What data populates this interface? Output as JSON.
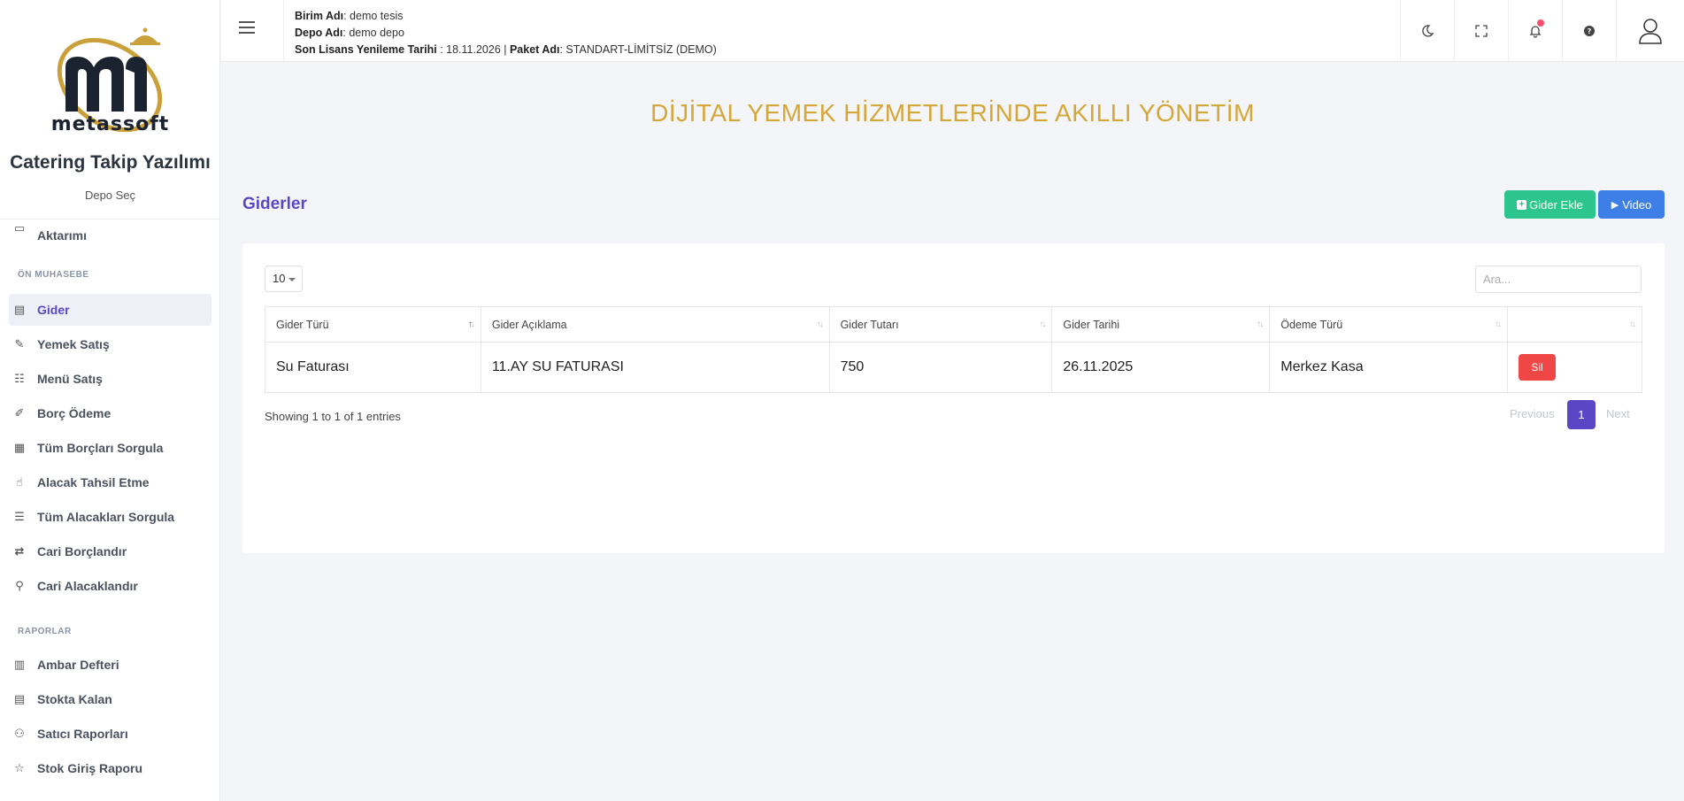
{
  "sidebar": {
    "logo_text": "metassoft",
    "app_title": "Catering Takip Yazılımı",
    "depo_sec": "Depo Seç",
    "partial_item": "Aktarımı",
    "section_on_muhasebe": "ÖN MUHASEBE",
    "section_raporlar": "RAPORLAR",
    "items": [
      {
        "label": "Gider",
        "icon": "register-icon"
      },
      {
        "label": "Yemek Satış",
        "icon": "food-sale-icon"
      },
      {
        "label": "Menü Satış",
        "icon": "menu-sale-icon"
      },
      {
        "label": "Borç Ödeme",
        "icon": "payment-icon"
      },
      {
        "label": "Tüm Borçları Sorgula",
        "icon": "debt-query-icon"
      },
      {
        "label": "Alacak Tahsil Etme",
        "icon": "collect-icon"
      },
      {
        "label": "Tüm Alacakları Sorgula",
        "icon": "receivable-query-icon"
      },
      {
        "label": "Cari Borçlandır",
        "icon": "debit-icon"
      },
      {
        "label": "Cari Alacaklandır",
        "icon": "credit-icon"
      }
    ],
    "report_items": [
      {
        "label": "Ambar Defteri",
        "icon": "ledger-icon"
      },
      {
        "label": "Stokta Kalan",
        "icon": "stock-icon"
      },
      {
        "label": "Satıcı Raporları",
        "icon": "seller-report-icon"
      },
      {
        "label": "Stok Giriş Raporu",
        "icon": "stock-entry-icon"
      }
    ]
  },
  "header": {
    "birim_label": "Birim Adı",
    "birim_value": ": demo tesis",
    "depo_label": "Depo Adı",
    "depo_value": ": demo depo",
    "lisans_label": "Son Lisans Yenileme Tarihi",
    "lisans_value": " : 18.11.2026 | ",
    "paket_label": "Paket Adı",
    "paket_value": ": STANDART-LİMİTSİZ (DEMO)"
  },
  "banner": "DİJİTAL YEMEK HİZMETLERİNDE AKILLI YÖNETİM",
  "page": {
    "title": "Giderler",
    "add_button": "Gider Ekle",
    "video_button": "Video"
  },
  "table": {
    "length_value": "10",
    "search_placeholder": "Ara...",
    "columns": [
      "Gider Türü",
      "Gider Açıklama",
      "Gider Tutarı",
      "Gider Tarihi",
      "Ödeme Türü",
      ""
    ],
    "rows": [
      {
        "tur": "Su Faturası",
        "aciklama": "11.AY SU FATURASI",
        "tutar": "750",
        "tarih": "26.11.2025",
        "odeme": "Merkez Kasa",
        "action": "Sil"
      }
    ],
    "entries_text": "Showing 1 to 1 of 1 entries",
    "prev": "Previous",
    "page": "1",
    "next": "Next"
  },
  "colors": {
    "accent": "#5b47c6",
    "gold": "#d4a73b",
    "green": "#2dc58e",
    "blue": "#3d7fe6",
    "danger": "#ef4646"
  }
}
